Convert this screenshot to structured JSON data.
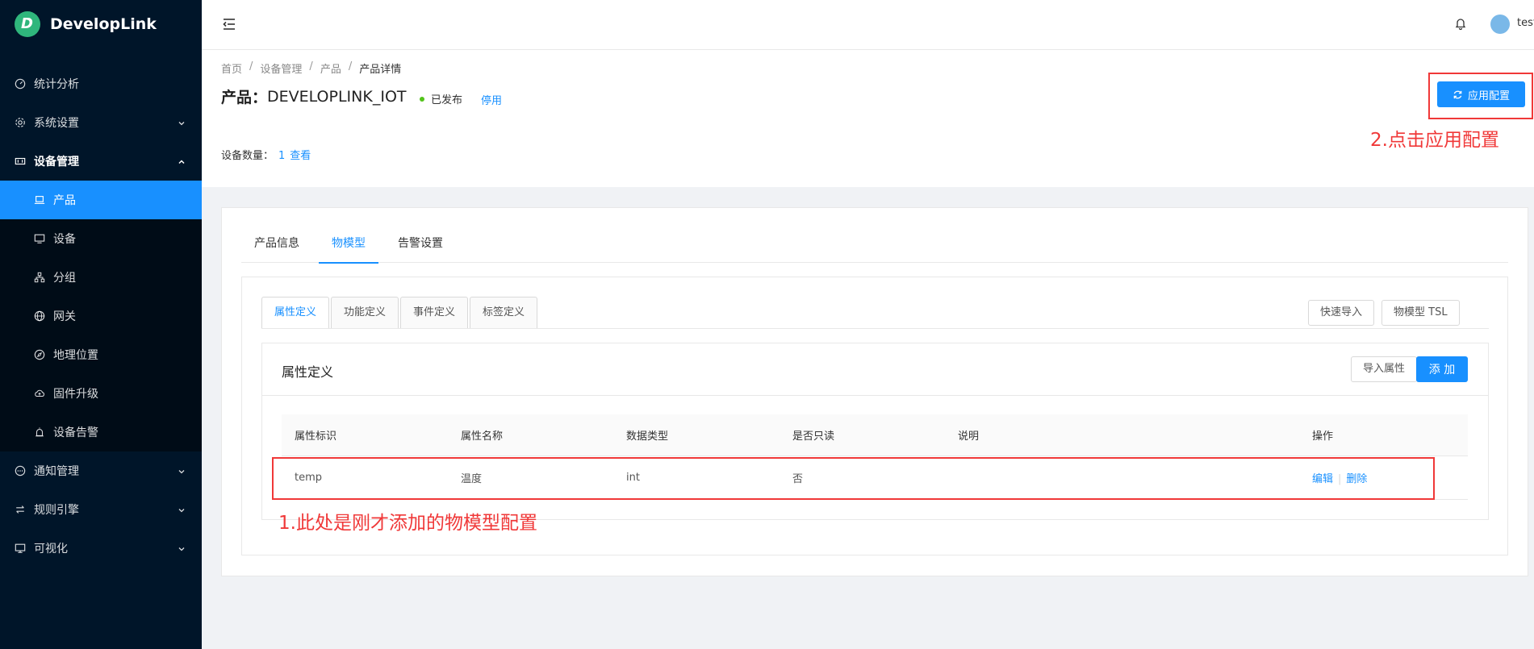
{
  "app": {
    "logo_letter": "D",
    "name": "DevelopLink"
  },
  "sidebar": {
    "items": [
      {
        "label": "统计分析",
        "icon": "dashboard-icon"
      },
      {
        "label": "系统设置",
        "icon": "gear-icon"
      },
      {
        "label": "设备管理",
        "icon": "device-manage-icon"
      },
      {
        "label": "产品",
        "icon": "laptop-icon"
      },
      {
        "label": "设备",
        "icon": "monitor-icon"
      },
      {
        "label": "分组",
        "icon": "cluster-icon"
      },
      {
        "label": "网关",
        "icon": "globe-icon"
      },
      {
        "label": "地理位置",
        "icon": "compass-icon"
      },
      {
        "label": "固件升级",
        "icon": "cloud-upload-icon"
      },
      {
        "label": "设备告警",
        "icon": "alarm-icon"
      },
      {
        "label": "通知管理",
        "icon": "message-icon"
      },
      {
        "label": "规则引擎",
        "icon": "swap-icon"
      },
      {
        "label": "可视化",
        "icon": "desktop-icon"
      }
    ]
  },
  "topbar": {
    "username": "test"
  },
  "breadcrumb": [
    "首页",
    "设备管理",
    "产品",
    "产品详情"
  ],
  "product": {
    "title_prefix": "产品：",
    "name": "DEVELOPLINK_IOT",
    "status": "已发布",
    "status_color": "#52c41a",
    "stop_label": "停用",
    "device_count_label": "设备数量：",
    "device_count": "1",
    "view_label": "查看",
    "apply_label": "应用配置"
  },
  "tabs": [
    "产品信息",
    "物模型",
    "告警设置"
  ],
  "subtabs": [
    "属性定义",
    "功能定义",
    "事件定义",
    "标签定义"
  ],
  "toolbar": {
    "quick_import": "快速导入",
    "tsl": "物模型 TSL"
  },
  "panel": {
    "title": "属性定义",
    "import_label": "导入属性",
    "add_label": "添 加"
  },
  "table": {
    "columns": [
      "属性标识",
      "属性名称",
      "数据类型",
      "是否只读",
      "说明",
      "操作"
    ],
    "rows": [
      {
        "id": "temp",
        "name": "温度",
        "type": "int",
        "readonly": "否",
        "desc": "",
        "edit": "编辑",
        "delete": "删除"
      }
    ]
  },
  "annotations": {
    "step1": "1.此处是刚才添加的物模型配置",
    "step2": "2.点击应用配置",
    "color": "#f03838"
  },
  "colors": {
    "sidebar_bg": "#001529",
    "primary": "#1890ff"
  }
}
